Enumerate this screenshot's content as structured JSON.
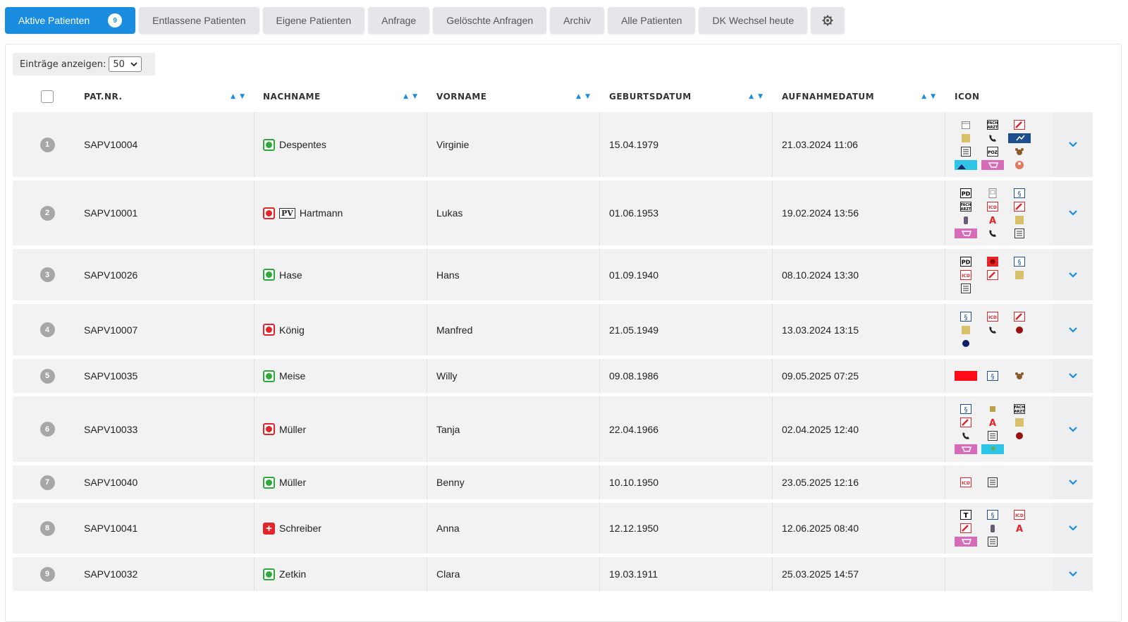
{
  "tabs": [
    {
      "label": "Aktive Patienten",
      "badge": "9",
      "active": true
    },
    {
      "label": "Entlassene Patienten"
    },
    {
      "label": "Eigene Patienten"
    },
    {
      "label": "Anfrage"
    },
    {
      "label": "Gelöschte Anfragen"
    },
    {
      "label": "Archiv"
    },
    {
      "label": "Alle Patienten"
    },
    {
      "label": "DK Wechsel heute"
    }
  ],
  "settings_icon": "gear-icon",
  "entries": {
    "label": "Einträge anzeigen:",
    "value": "50"
  },
  "columns": {
    "patnr": "PAT.NR.",
    "nachname": "NACHNAME",
    "vorname": "VORNAME",
    "geburtsdatum": "GEBURTSDATUM",
    "aufnahmedatum": "AUFNAHMEDATUM",
    "icon": "ICON"
  },
  "colors": {
    "accent": "#1a8de0",
    "status_green": "#2eaa3b",
    "status_red": "#e3242b"
  },
  "rows": [
    {
      "num": "1",
      "patnr": "SAPV10004",
      "status": "green",
      "pv": "",
      "nachname": "Despentes",
      "vorname": "Virginie",
      "geburtsdatum": "15.04.1979",
      "aufnahmedatum": "21.03.2024 11:06",
      "icons": [
        "calendar",
        "facharzt",
        "pen-red",
        "sticky-note",
        "phone",
        "chart-blue",
        "list",
        "poz",
        "dog",
        "landscape",
        "cart-pink",
        "person-round"
      ]
    },
    {
      "num": "2",
      "patnr": "SAPV10001",
      "status": "red",
      "pv": "PV",
      "nachname": "Hartmann",
      "vorname": "Lukas",
      "geburtsdatum": "01.06.1953",
      "aufnahmedatum": "19.02.2024 13:56",
      "icons": [
        "pd",
        "document",
        "bracket",
        "facharzt",
        "icd",
        "pen-red",
        "bottle",
        "pharmacy",
        "sticky-note",
        "cart-pink",
        "phone",
        "list"
      ]
    },
    {
      "num": "3",
      "patnr": "SAPV10026",
      "status": "green",
      "pv": "",
      "nachname": "Hase",
      "vorname": "Hans",
      "geburtsdatum": "01.09.1940",
      "aufnahmedatum": "08.10.2024 13:30",
      "icons": [
        "pd",
        "alert-red",
        "bracket",
        "icd",
        "pen-red",
        "sticky-note",
        "list"
      ]
    },
    {
      "num": "4",
      "patnr": "SAPV10007",
      "status": "red",
      "pv": "",
      "nachname": "König",
      "vorname": "Manfred",
      "geburtsdatum": "21.05.1949",
      "aufnahmedatum": "13.03.2024 13:15",
      "icons": [
        "bracket",
        "icd",
        "pen-red",
        "sticky-note",
        "phone",
        "ball-red",
        "ball-blue"
      ]
    },
    {
      "num": "5",
      "patnr": "SAPV10035",
      "status": "green",
      "pv": "",
      "nachname": "Meise",
      "vorname": "Willy",
      "geburtsdatum": "09.08.1986",
      "aufnahmedatum": "09.05.2025 07:25",
      "icons": [
        "red-bar",
        "bracket",
        "dog"
      ]
    },
    {
      "num": "6",
      "patnr": "SAPV10033",
      "status": "red",
      "pv": "",
      "nachname": "Müller",
      "vorname": "Tanja",
      "geburtsdatum": "22.04.1966",
      "aufnahmedatum": "02.04.2025 12:40",
      "icons": [
        "bracket",
        "sticky-small",
        "facharzt",
        "pen-red",
        "pharmacy",
        "sticky-note",
        "phone",
        "list",
        "ball-red",
        "cart-pink",
        "person-cyan"
      ]
    },
    {
      "num": "7",
      "patnr": "SAPV10040",
      "status": "green",
      "pv": "",
      "nachname": "Müller",
      "vorname": "Benny",
      "geburtsdatum": "10.10.1950",
      "aufnahmedatum": "23.05.2025 12:16",
      "icons": [
        "icd",
        "list"
      ]
    },
    {
      "num": "8",
      "patnr": "SAPV10041",
      "status": "cross",
      "pv": "",
      "nachname": "Schreiber",
      "vorname": "Anna",
      "geburtsdatum": "12.12.1950",
      "aufnahmedatum": "12.06.2025 08:40",
      "icons": [
        "t-box",
        "bracket",
        "icd",
        "pen-red",
        "bottle",
        "pharmacy",
        "cart-pink",
        "list"
      ]
    },
    {
      "num": "9",
      "patnr": "SAPV10032",
      "status": "green",
      "pv": "",
      "nachname": "Zetkin",
      "vorname": "Clara",
      "geburtsdatum": "19.03.1911",
      "aufnahmedatum": "25.03.2025 14:57",
      "icons": []
    }
  ]
}
